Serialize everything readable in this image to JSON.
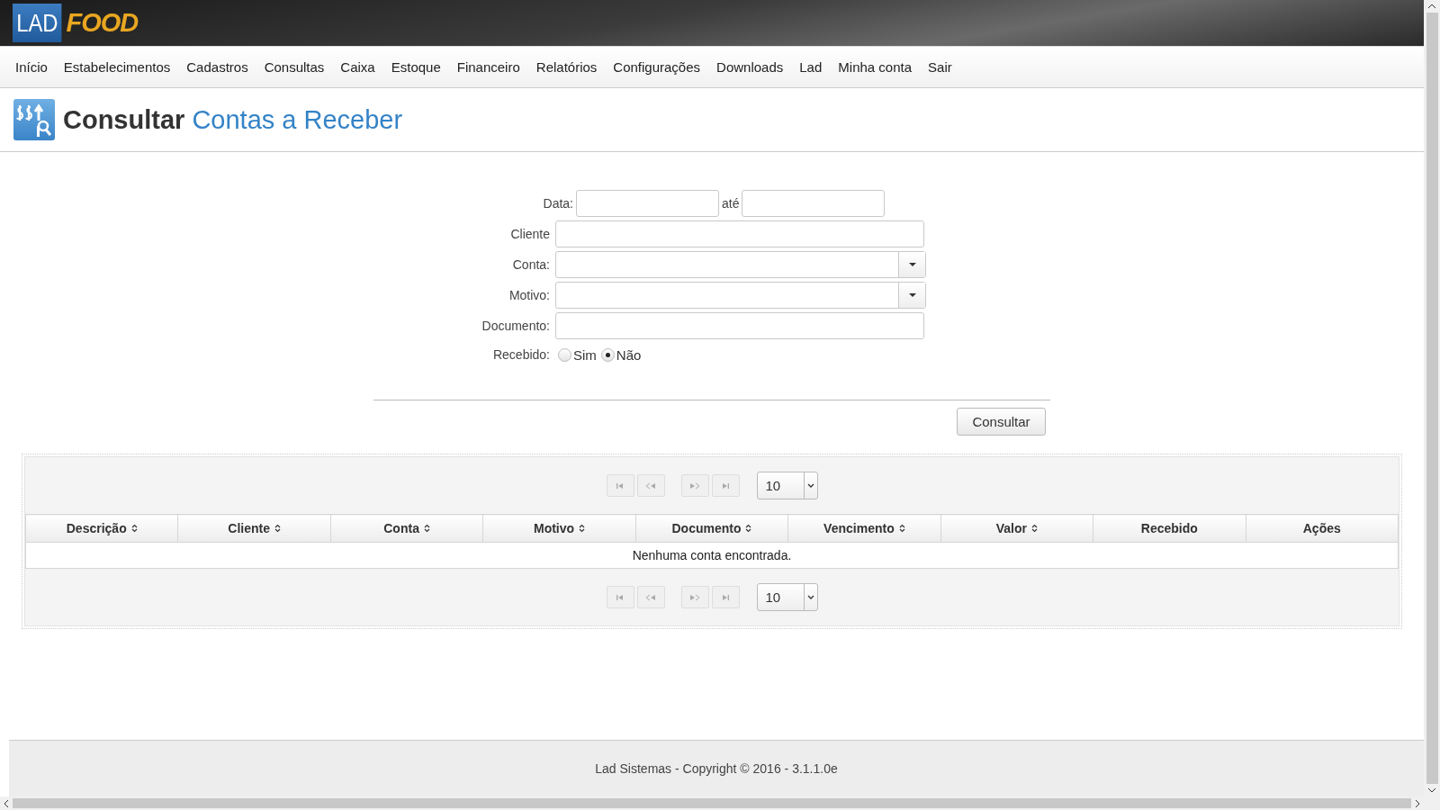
{
  "header": {
    "logo_left": "LAD",
    "logo_right": "FOOD"
  },
  "nav": [
    "Início",
    "Estabelecimentos",
    "Cadastros",
    "Consultas",
    "Caixa",
    "Estoque",
    "Financeiro",
    "Relatórios",
    "Configurações",
    "Downloads",
    "Lad",
    "Minha conta",
    "Sair"
  ],
  "page_title": {
    "prefix": "Consultar",
    "subject": "Contas a Receber"
  },
  "form": {
    "date_label": "Data:",
    "date_to_label": "até",
    "fields": [
      {
        "kind": "text",
        "label": "Cliente"
      },
      {
        "kind": "select",
        "label": "Conta:"
      },
      {
        "kind": "select",
        "label": "Motivo:"
      },
      {
        "kind": "text",
        "label": "Documento:"
      }
    ],
    "received": {
      "label": "Recebido:",
      "options": [
        {
          "label": "Sim",
          "selected": false
        },
        {
          "label": "Não",
          "selected": true
        }
      ]
    },
    "submit": "Consultar"
  },
  "table": {
    "top_pager": {
      "page_size": "10"
    },
    "columns": [
      {
        "label": "Descrição",
        "sortable": true
      },
      {
        "label": "Cliente",
        "sortable": true
      },
      {
        "label": "Conta",
        "sortable": true
      },
      {
        "label": "Motivo",
        "sortable": true
      },
      {
        "label": "Documento",
        "sortable": true
      },
      {
        "label": "Vencimento",
        "sortable": true
      },
      {
        "label": "Valor",
        "sortable": true
      },
      {
        "label": "Recebido",
        "sortable": false
      },
      {
        "label": "Ações",
        "sortable": false
      }
    ],
    "empty_message": "Nenhuma conta encontrada.",
    "bottom_pager": {
      "page_size": "10"
    }
  },
  "footer": "Lad Sistemas - Copyright © 2016 - 3.1.1.0e"
}
